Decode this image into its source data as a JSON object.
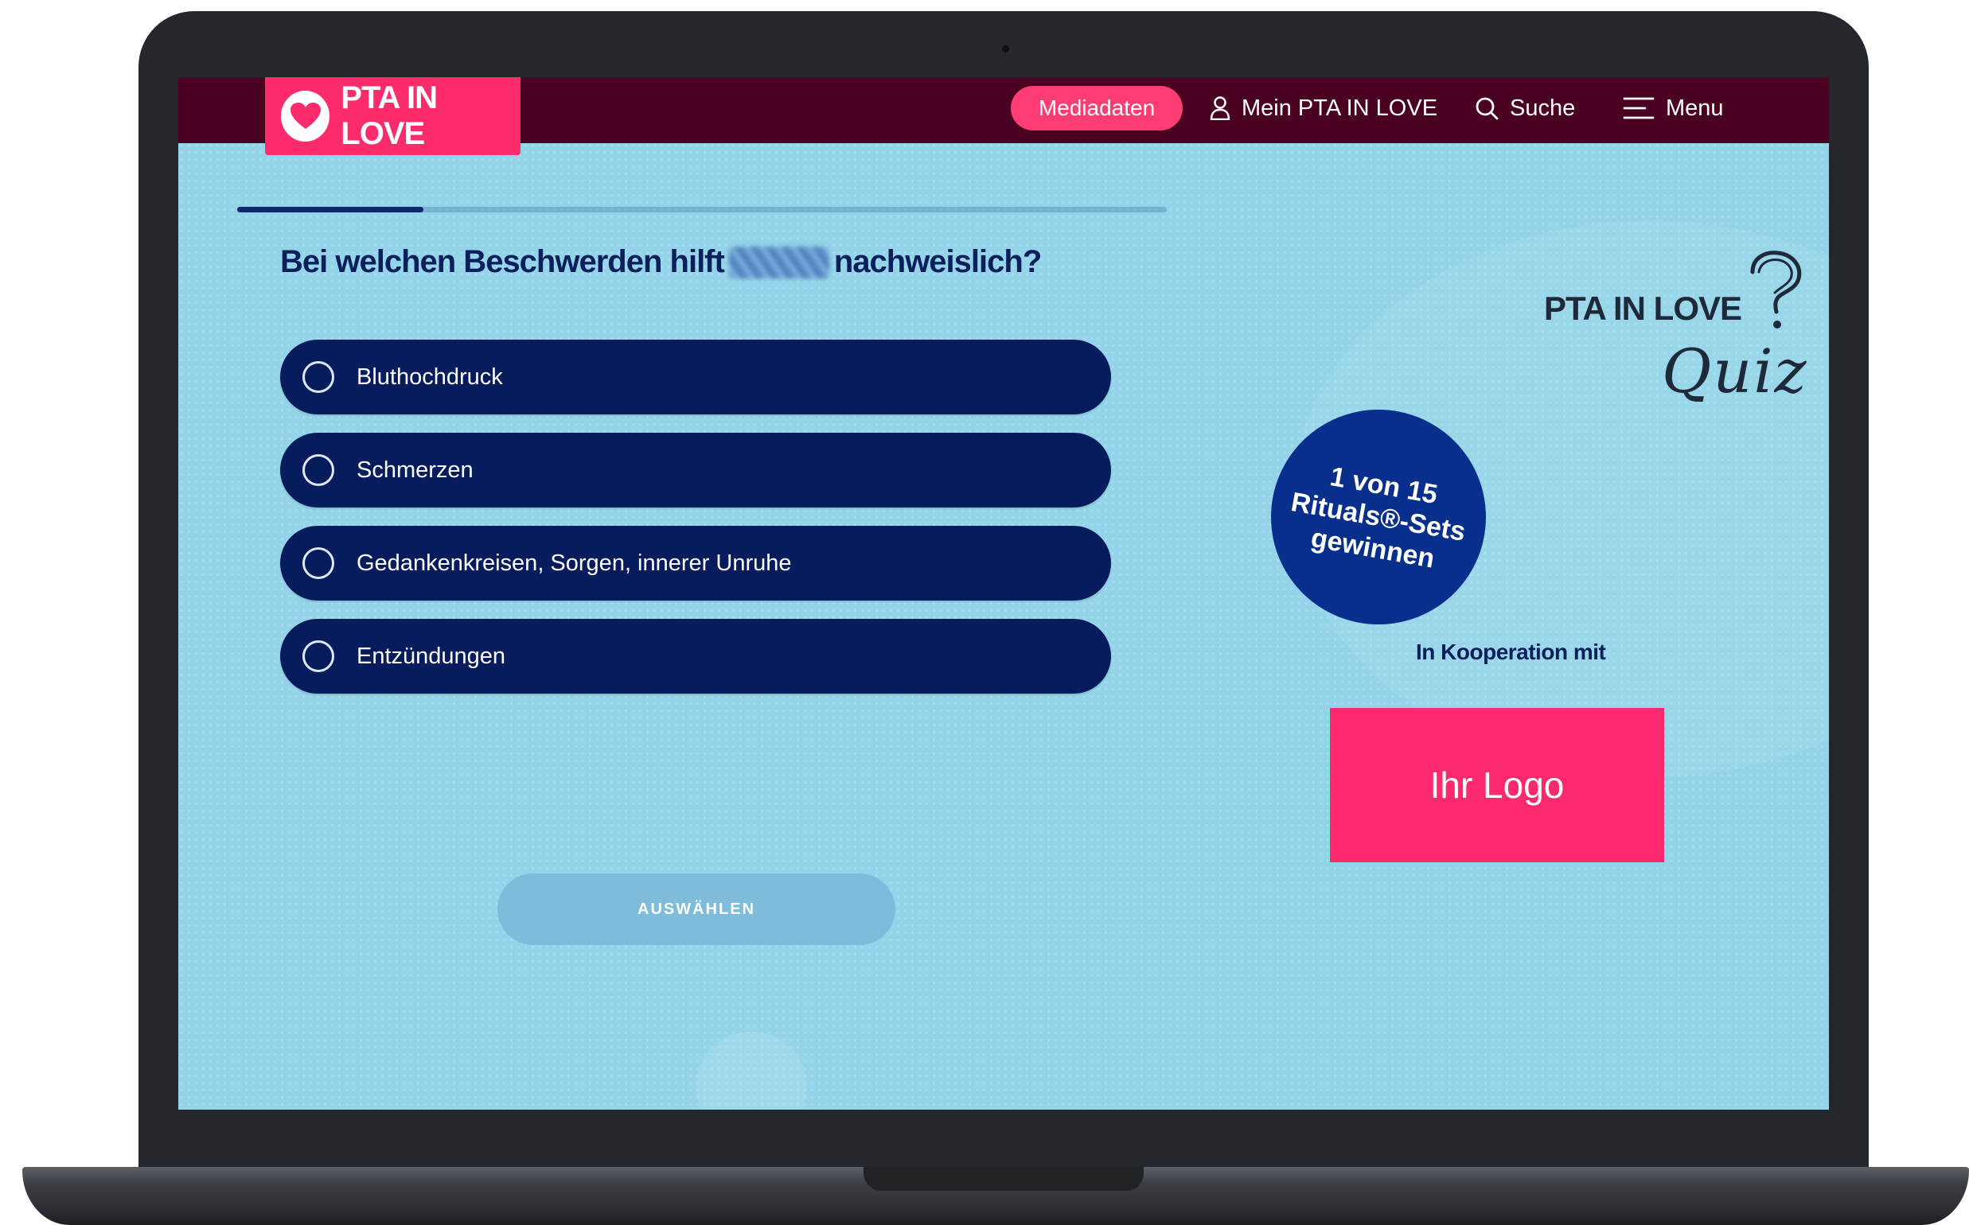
{
  "header": {
    "logo_text": "PTA IN LOVE",
    "mediadaten_label": "Mediadaten",
    "account_label": "Mein PTA IN LOVE",
    "search_label": "Suche",
    "menu_label": "Menu"
  },
  "quiz": {
    "progress_fraction": 0.2,
    "question_before": "Bei welchen Beschwerden hilft",
    "question_after": "nachweislich?",
    "answers": [
      {
        "label": "Bluthochdruck"
      },
      {
        "label": "Schmerzen"
      },
      {
        "label": "Gedankenkreisen, Sorgen, innerer Unruhe"
      },
      {
        "label": "Entzündungen"
      }
    ],
    "submit_label": "AUSWÄHLEN"
  },
  "sidebar": {
    "brand_name": "PTA IN LOVE",
    "brand_quiz": "Quiz",
    "badge_text": "1 von 15\nRituals®-Sets\ngewinnen",
    "cooperation_label": "In Kooperation mit",
    "partner_logo_text": "Ihr Logo"
  },
  "colors": {
    "header_bg": "#4a0020",
    "accent_pink": "#ff2c6d",
    "answer_bg": "#061c5c",
    "screen_bg": "#94d4e8",
    "badge_bg": "#082f8c"
  },
  "icons": {
    "logo": "heart-icon",
    "account": "user-icon",
    "search": "search-icon",
    "menu": "hamburger-icon",
    "quiz_brand": "question-mark-icon"
  }
}
